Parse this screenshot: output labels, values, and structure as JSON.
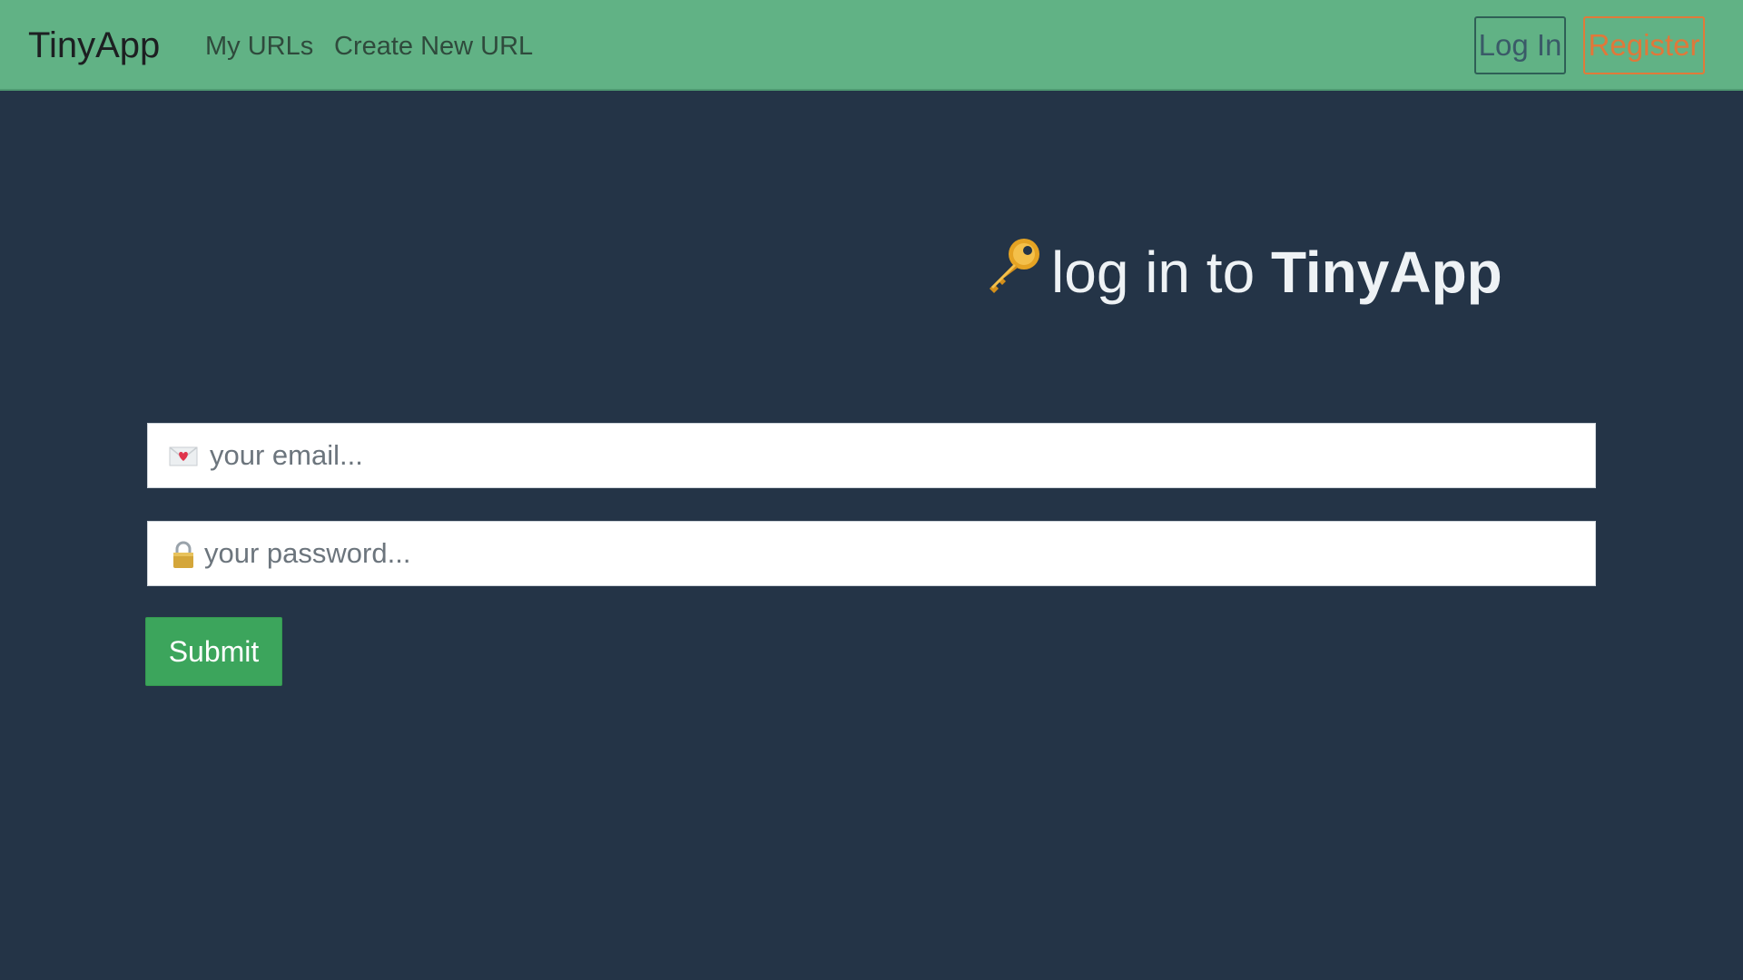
{
  "navbar": {
    "brand": "TinyApp",
    "links": [
      "My URLs",
      "Create New URL"
    ],
    "login_label": "Log In",
    "register_label": "Register",
    "colors": {
      "background": "#61b285",
      "login_border": "#2f5f56",
      "register": "#e0783a"
    }
  },
  "main": {
    "heading_prefix": "log in to",
    "heading_brand": "TinyApp",
    "heading_icon": "key-icon",
    "email": {
      "placeholder": "your email...",
      "icon": "love-letter-icon",
      "value": ""
    },
    "password": {
      "placeholder": "your password...",
      "icon": "lock-icon",
      "value": ""
    },
    "submit_label": "Submit",
    "colors": {
      "background": "#243447",
      "submit": "#3ca55c"
    }
  }
}
